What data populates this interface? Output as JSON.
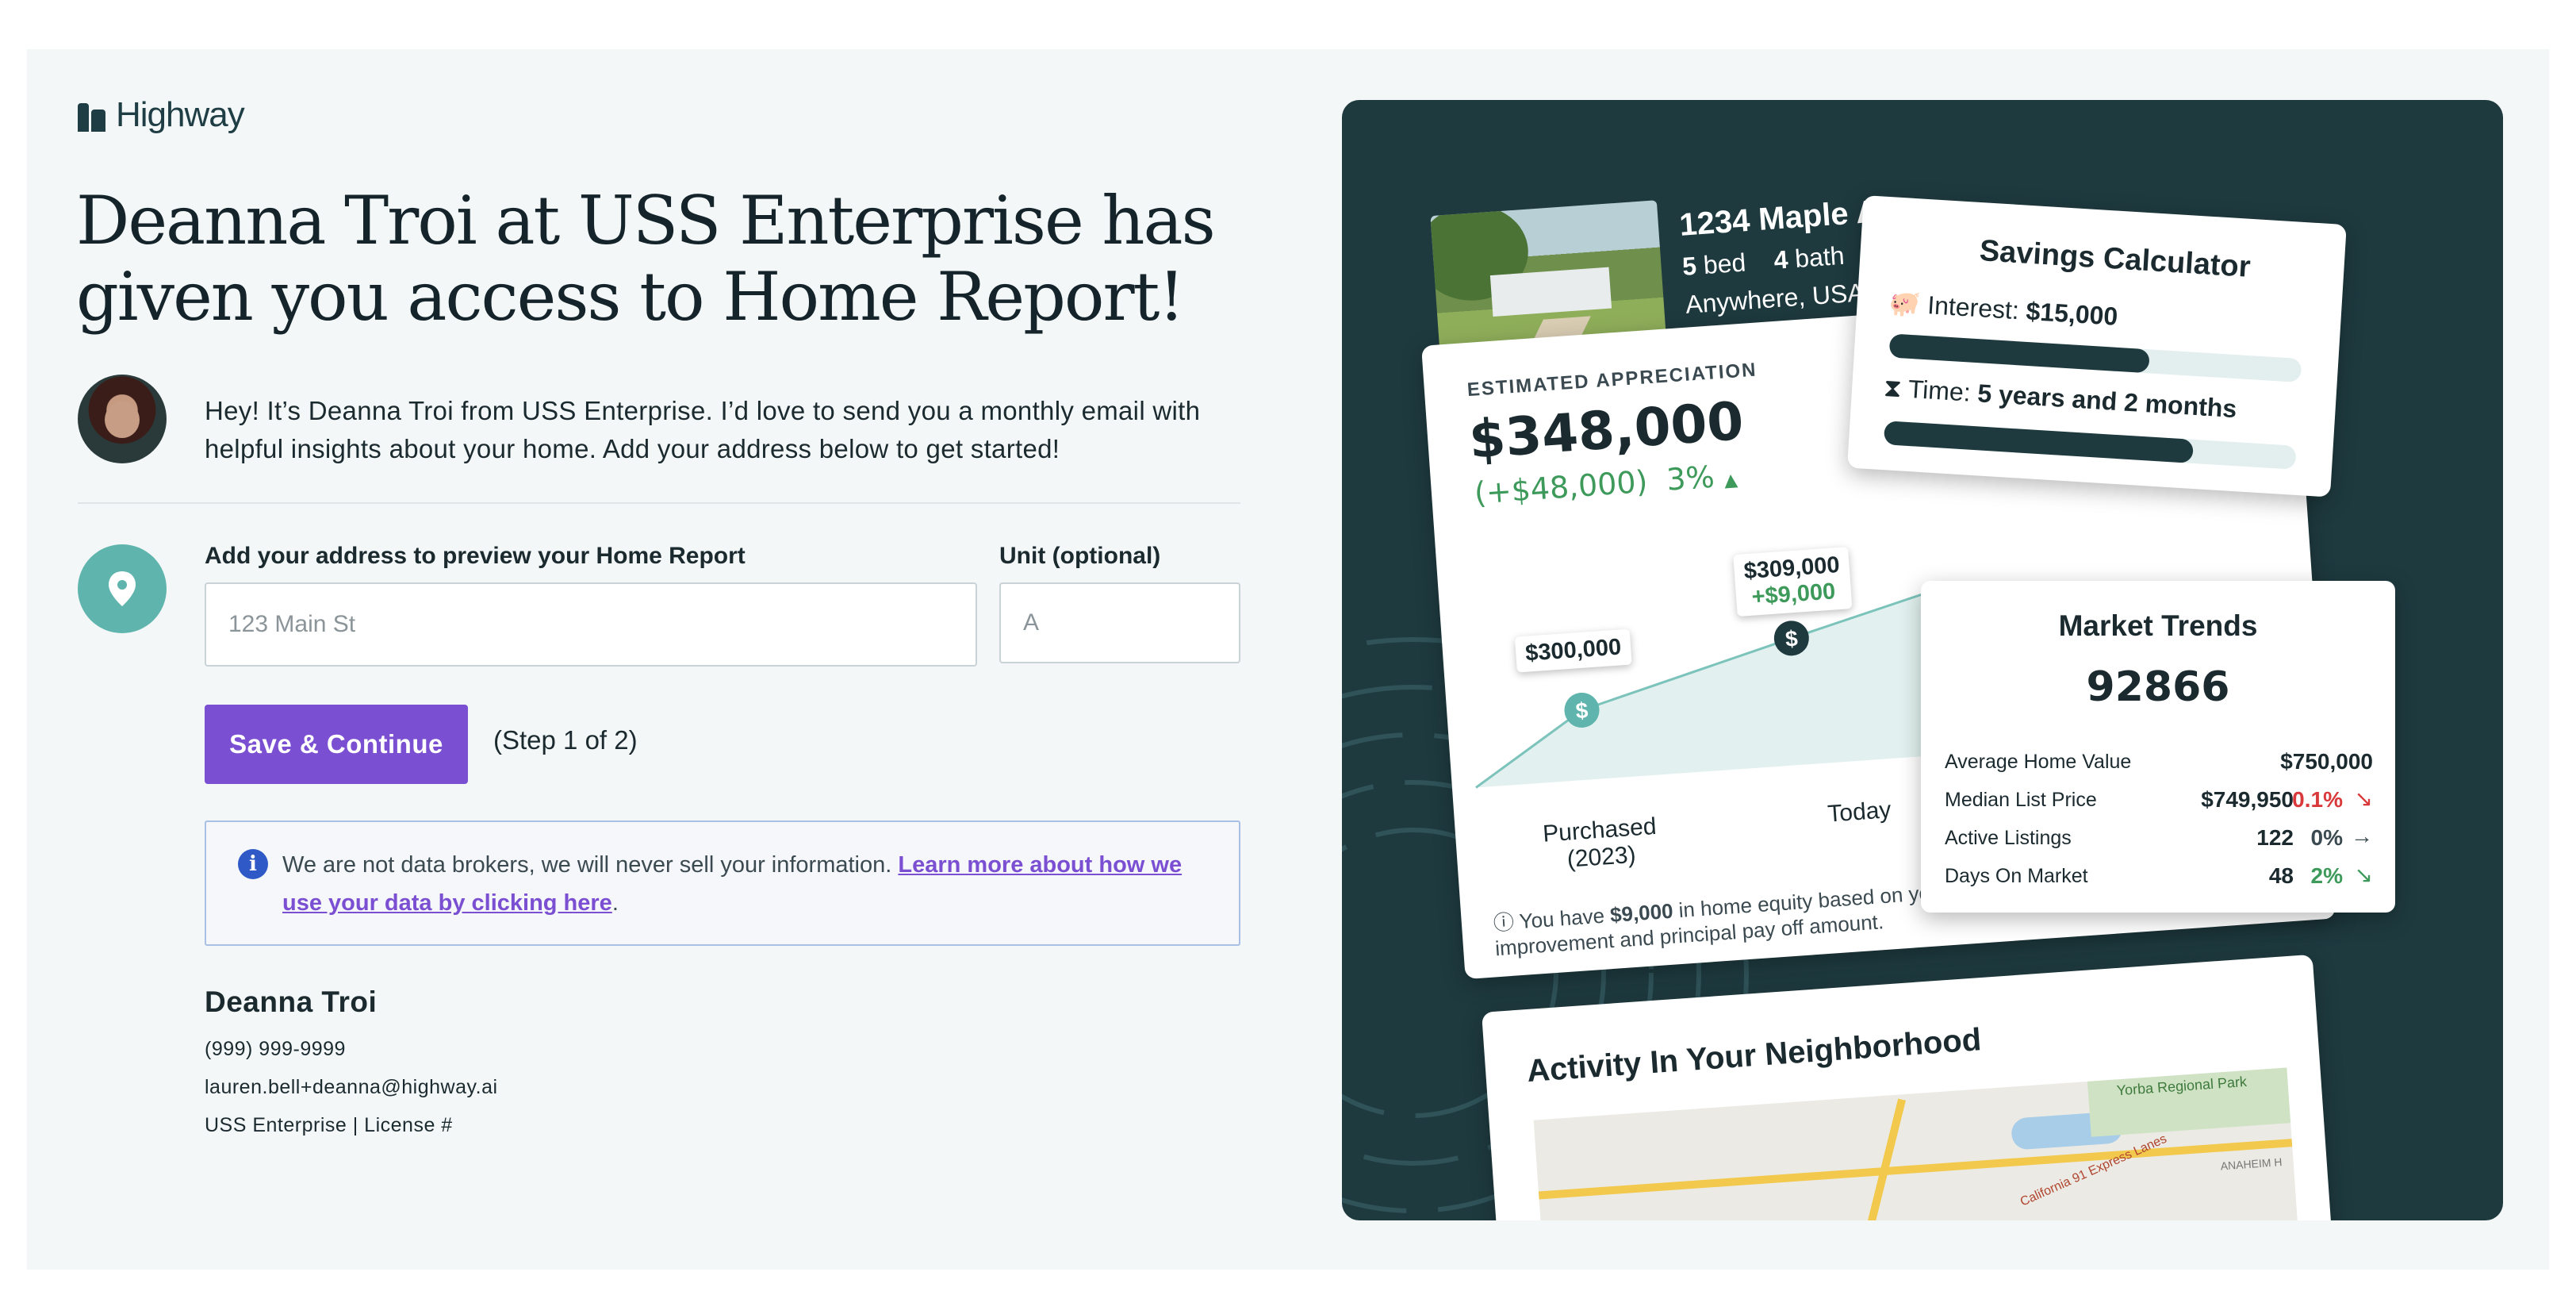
{
  "brand": {
    "name": "Highway"
  },
  "headline": "Deanna Troi at USS Enterprise has given you access to Home Report!",
  "intro": "Hey! It’s Deanna Troi from USS Enterprise. I’d love to send you a monthly email with helpful insights about your home. Add your address below to get started!",
  "form": {
    "address_label": "Add your address to preview your Home Report",
    "address_placeholder": "123 Main St",
    "address_value": "",
    "unit_label": "Unit (optional)",
    "unit_placeholder": "A",
    "unit_value": "",
    "save_label": "Save & Continue",
    "step_text": "(Step 1 of 2)"
  },
  "notice": {
    "text": "We are not data brokers, we will never sell your information.",
    "link_text": "Learn more about how we use your data by clicking here",
    "suffix": "."
  },
  "agent": {
    "name": "Deanna Troi",
    "phone": "(999) 999-9999",
    "email": "lauren.bell+deanna@highway.ai",
    "company_license": "USS Enterprise | License #"
  },
  "preview": {
    "property": {
      "street": "1234 Maple Av",
      "beds": "5",
      "beds_label": "bed",
      "baths": "4",
      "baths_label": "bath",
      "region": "Anywhere, USA"
    },
    "appreciation": {
      "label": "ESTIMATED APPRECIATION",
      "value": "$348,000",
      "change": "(+$48,000)",
      "percent": "3%",
      "points": [
        {
          "price": "$300,000",
          "delta": "",
          "x_label": "Purchased",
          "x_sub": "(2023)"
        },
        {
          "price": "$309,000",
          "delta": "+$9,000",
          "x_label": "",
          "x_sub": ""
        },
        {
          "price": "",
          "delta": "",
          "x_label": "Today",
          "x_sub": ""
        }
      ],
      "footnote_prefix": "You have ",
      "footnote_bold": "$9,000",
      "footnote_suffix": " in home equity based on your estimated home value improvement and principal pay off amount."
    },
    "savings": {
      "title": "Savings Calculator",
      "interest_label": "Interest:",
      "interest_value": "$15,000",
      "interest_progress": 0.63,
      "time_label": "Time:",
      "time_value": "5 years and 2 months",
      "time_progress": 0.75
    },
    "trends": {
      "title": "Market Trends",
      "zip": "92866",
      "rows": [
        {
          "label": "Average Home Value",
          "value": "$750,000",
          "pct": "",
          "trend": "none"
        },
        {
          "label": "Median List Price",
          "value": "$749,950",
          "pct": "0.1%",
          "trend": "down",
          "color": "#d9393b"
        },
        {
          "label": "Active Listings",
          "value": "122",
          "pct": "0%",
          "trend": "flat",
          "color": "#3b4a50"
        },
        {
          "label": "Days On Market",
          "value": "48",
          "pct": "2%",
          "trend": "down",
          "color": "#3e9a5b"
        }
      ]
    },
    "neighborhood": {
      "title": "Activity In Your Neighborhood",
      "map_labels": [
        "Yorba Regional Park",
        "California 91 Express Lanes",
        "ANAHEIM H"
      ]
    }
  },
  "colors": {
    "accent": "#7b4fd2",
    "teal": "#5fb5ad",
    "dark_panel": "#1e3a3f",
    "positive": "#3e9a5b",
    "negative": "#d9393b"
  }
}
